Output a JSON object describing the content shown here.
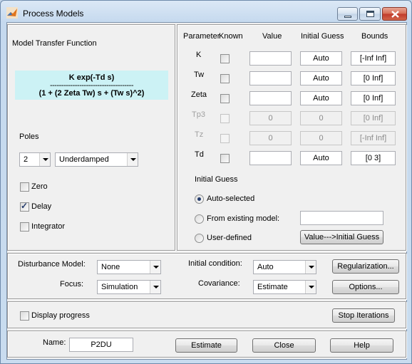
{
  "window": {
    "title": "Process Models"
  },
  "left_panel": {
    "heading": "Model Transfer Function",
    "tf_numerator": "K exp(-Td s)",
    "tf_divider": "-------------------------------------",
    "tf_denominator": "(1 + (2 Zeta Tw) s + (Tw s)^2)",
    "poles_label": "Poles",
    "poles_value": "2",
    "pole_type": "Underdamped",
    "zero_label": "Zero",
    "delay_label": "Delay",
    "integrator_label": "Integrator",
    "zero_checked": false,
    "delay_checked": true,
    "integrator_checked": false
  },
  "param_table": {
    "headers": {
      "parameter": "Parameter",
      "known": "Known",
      "value": "Value",
      "initial_guess": "Initial Guess",
      "bounds": "Bounds"
    },
    "rows": [
      {
        "name": "K",
        "value": "",
        "initial_guess": "Auto",
        "bounds": "[-Inf Inf]",
        "enabled": true
      },
      {
        "name": "Tw",
        "value": "",
        "initial_guess": "Auto",
        "bounds": "[0 Inf]",
        "enabled": true
      },
      {
        "name": "Zeta",
        "value": "",
        "initial_guess": "Auto",
        "bounds": "[0 Inf]",
        "enabled": true
      },
      {
        "name": "Tp3",
        "value": "0",
        "initial_guess": "0",
        "bounds": "[0 Inf]",
        "enabled": false
      },
      {
        "name": "Tz",
        "value": "0",
        "initial_guess": "0",
        "bounds": "[-Inf Inf]",
        "enabled": false
      },
      {
        "name": "Td",
        "value": "",
        "initial_guess": "Auto",
        "bounds": "[0 3]",
        "enabled": true
      }
    ]
  },
  "initial_guess": {
    "heading": "Initial Guess",
    "auto_selected": "Auto-selected",
    "from_existing": "From existing model:",
    "from_existing_value": "",
    "user_defined": "User-defined",
    "value_button": "Value--->Initial Guess",
    "selected": "auto_selected"
  },
  "options_panel": {
    "disturbance_label": "Disturbance Model:",
    "disturbance_value": "None",
    "focus_label": "Focus:",
    "focus_value": "Simulation",
    "initial_condition_label": "Initial condition:",
    "initial_condition_value": "Auto",
    "covariance_label": "Covariance:",
    "covariance_value": "Estimate",
    "regularization_button": "Regularization...",
    "options_button": "Options..."
  },
  "progress_panel": {
    "display_progress_label": "Display progress",
    "display_progress_checked": false,
    "stop_button": "Stop Iterations"
  },
  "bottom_panel": {
    "name_label": "Name:",
    "name_value": "P2DU",
    "estimate_button": "Estimate",
    "close_button": "Close",
    "help_button": "Help"
  },
  "colors": {
    "tf_background": "#ccf2f5",
    "close_button": "#c0392b",
    "window_frame": "#c5d9ee"
  }
}
